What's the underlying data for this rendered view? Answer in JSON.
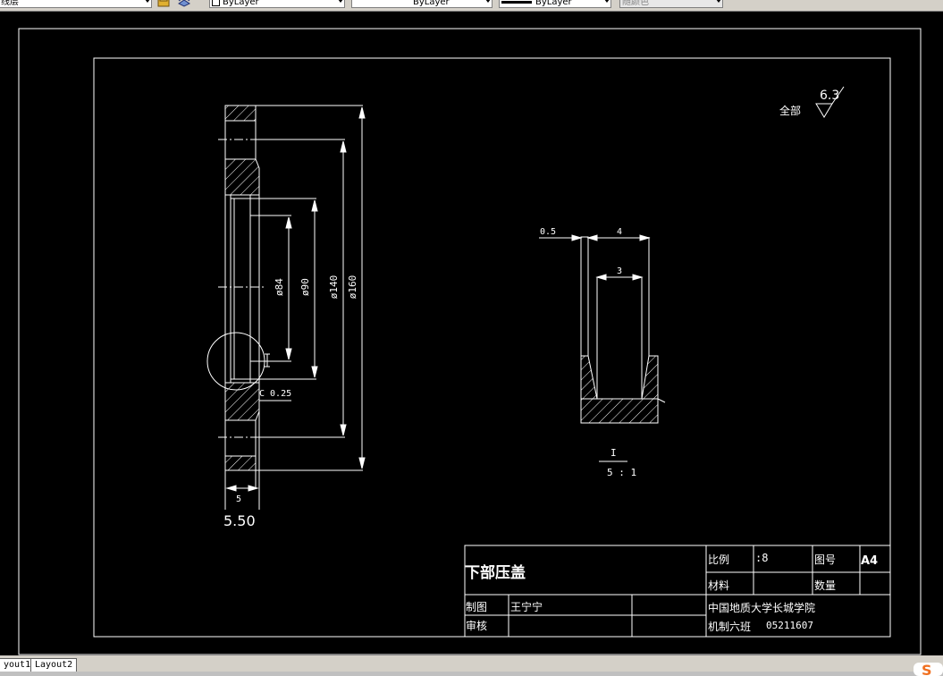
{
  "toolbar": {
    "layer_combo": "线层",
    "color_combo": "ByLayer",
    "linetype_combo": "ByLayer",
    "lineweight_combo": "ByLayer",
    "plotstyle_combo": "随颜色"
  },
  "tabs": [
    "yout1",
    "Layout2"
  ],
  "drawing": {
    "surface_symbol_label": "全部",
    "roughness_value": "6.3",
    "dim_phi84": "ø84",
    "dim_phi90": "ø90",
    "dim_phi140": "ø140",
    "dim_phi160": "ø160",
    "chamfer": "C 0.25",
    "dim_5": "5",
    "dim_550": "5.50",
    "detail_05": "0.5",
    "detail_4": "4",
    "detail_3": "3",
    "detail_ref": "I",
    "detail_scale": "5 : 1",
    "circle_ref": "I"
  },
  "title_block": {
    "part_name": "下部压盖",
    "scale_label": "比例",
    "scale_value": ":8",
    "drawing_no_label": "图号",
    "drawing_no_value": "A4",
    "material_label": "材料",
    "quantity_label": "数量",
    "drawn_label": "制图",
    "drawn_name": "王宁宁",
    "checked_label": "审核",
    "school": "中国地质大学长城学院",
    "class": "机制六班",
    "student_id": "05211607"
  }
}
